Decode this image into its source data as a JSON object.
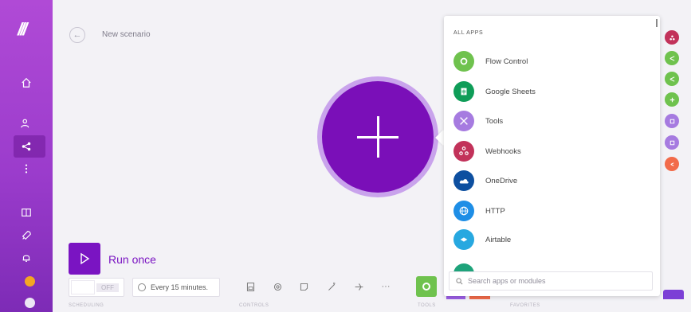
{
  "header": {
    "title": "New scenario"
  },
  "run": {
    "label": "Run once"
  },
  "scheduling": {
    "toggle_state": "OFF",
    "interval": "Every 15 minutes.",
    "label": "SCHEDULING"
  },
  "toolbar": {
    "controls_label": "CONTROLS",
    "tools_label": "TOOLS",
    "favorites_label": "FAVORITES",
    "more": "···"
  },
  "popup": {
    "heading": "ALL APPS",
    "apps": [
      {
        "name": "Flow Control",
        "color": "#6fc24e",
        "icon": "flow-control-icon"
      },
      {
        "name": "Google Sheets",
        "color": "#0f9d58",
        "icon": "google-sheets-icon"
      },
      {
        "name": "Tools",
        "color": "#a67be0",
        "icon": "tools-icon"
      },
      {
        "name": "Webhooks",
        "color": "#c2325a",
        "icon": "webhooks-icon"
      },
      {
        "name": "OneDrive",
        "color": "#0d4fa0",
        "icon": "onedrive-icon"
      },
      {
        "name": "HTTP",
        "color": "#1e8ee6",
        "icon": "http-icon"
      },
      {
        "name": "Airtable",
        "color": "#27a8e0",
        "icon": "airtable-icon"
      }
    ],
    "search_placeholder": "Search apps or modules"
  },
  "colors": {
    "accent": "#7a0fb8",
    "sidebar": "#9b3ccc",
    "orange_dot": "#f4a623"
  }
}
